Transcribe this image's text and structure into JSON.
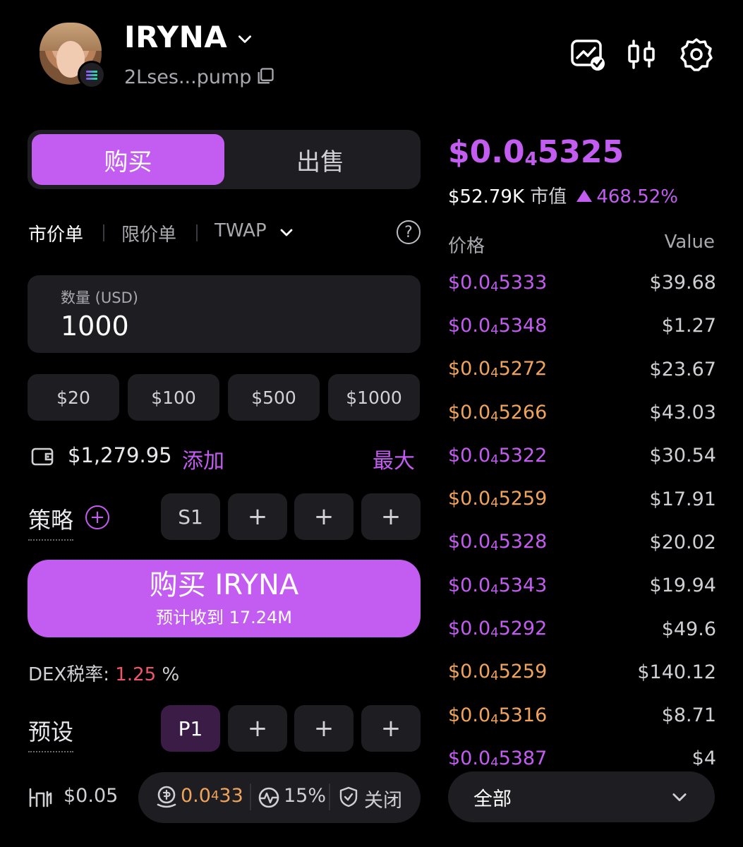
{
  "header": {
    "token_name": "IRYNA",
    "token_address": "2Lses...pump",
    "icons": [
      "chart-check-icon",
      "candlestick-icon",
      "gear-icon"
    ]
  },
  "trade_panel": {
    "tabs": {
      "buy": "购买",
      "sell": "出售",
      "active": "buy"
    },
    "order_types": [
      "市价单",
      "限价单",
      "TWAP"
    ],
    "help_glyph": "?",
    "amount": {
      "label": "数量 (USD)",
      "value": "1000"
    },
    "quick_amounts": [
      "$20",
      "$100",
      "$500",
      "$1000"
    ],
    "balance": "$1,279.95",
    "add_label": "添加",
    "max_label": "最大",
    "strategy": {
      "label": "策略",
      "slots": [
        "S1",
        "+",
        "+",
        "+"
      ]
    },
    "buy_button": {
      "label": "购买 IRYNA",
      "sub": "预计收到 17.24M"
    },
    "dex_tax": {
      "label": "DEX税率:",
      "value": "1.25",
      "unit": "%"
    },
    "preset": {
      "label": "预设",
      "slots": [
        "P1",
        "+",
        "+",
        "+"
      ]
    },
    "gas": "$0.05",
    "priority_fee": {
      "prefix": "0.0",
      "sub": "4",
      "suffix": "33"
    },
    "slippage": "15%",
    "mev": "关闭"
  },
  "market": {
    "price": {
      "prefix": "$0.0",
      "sub": "4",
      "suffix": "5325"
    },
    "market_cap": "$52.79K",
    "market_cap_label": "市值",
    "change": "468.52%",
    "columns": {
      "price": "价格",
      "value": "Value"
    },
    "trades": [
      {
        "suffix": "5333",
        "value": "$39.68",
        "side": "buy"
      },
      {
        "suffix": "5348",
        "value": "$1.27",
        "side": "buy"
      },
      {
        "suffix": "5272",
        "value": "$23.67",
        "side": "sell"
      },
      {
        "suffix": "5266",
        "value": "$43.03",
        "side": "sell"
      },
      {
        "suffix": "5322",
        "value": "$30.54",
        "side": "buy"
      },
      {
        "suffix": "5259",
        "value": "$17.91",
        "side": "sell"
      },
      {
        "suffix": "5328",
        "value": "$20.02",
        "side": "buy"
      },
      {
        "suffix": "5343",
        "value": "$19.94",
        "side": "buy"
      },
      {
        "suffix": "5292",
        "value": "$49.6",
        "side": "buy"
      },
      {
        "suffix": "5259",
        "value": "$140.12",
        "side": "sell"
      },
      {
        "suffix": "5316",
        "value": "$8.71",
        "side": "sell"
      },
      {
        "suffix": "5387",
        "value": "$4",
        "side": "buy"
      }
    ],
    "trade_price_prefix": "$0.0",
    "trade_price_sub": "4",
    "filter": "全部"
  },
  "colors": {
    "accent": "#c35cf0",
    "sell": "#f0a35b",
    "tax": "#f0566a",
    "surface": "#1e1e22"
  }
}
